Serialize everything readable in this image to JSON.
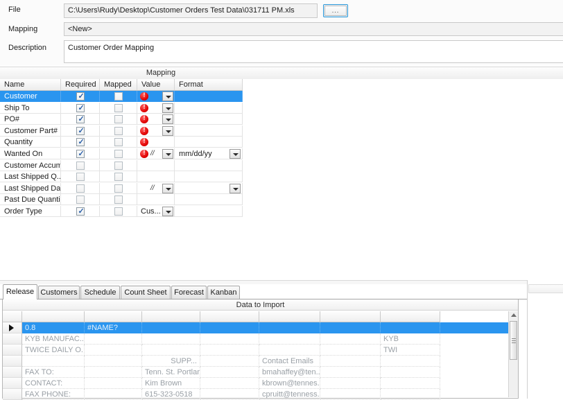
{
  "form": {
    "file_label": "File",
    "file_value": "C:\\Users\\Rudy\\Desktop\\Customer Orders Test Data\\031711 PM.xls",
    "browse_label": "...",
    "mapping_label": "Mapping",
    "mapping_value": "<New>",
    "description_label": "Description",
    "description_value": "Customer Order Mapping"
  },
  "mapping_band": {
    "title": "Mapping"
  },
  "grid": {
    "columns": [
      "Name",
      "Required",
      "Mapped",
      "Value",
      "Format"
    ],
    "rows": [
      {
        "name": "Customer",
        "required": true,
        "mapped": false,
        "error": true,
        "value_dropdown": true,
        "value_text": "",
        "slash": false,
        "format": "",
        "format_dropdown": false,
        "selected": true
      },
      {
        "name": "Ship To",
        "required": true,
        "mapped": false,
        "error": true,
        "value_dropdown": true,
        "value_text": "",
        "slash": false,
        "format": "",
        "format_dropdown": false,
        "selected": false
      },
      {
        "name": "PO#",
        "required": true,
        "mapped": false,
        "error": true,
        "value_dropdown": true,
        "value_text": "",
        "slash": false,
        "format": "",
        "format_dropdown": false,
        "selected": false
      },
      {
        "name": "Customer Part#",
        "required": true,
        "mapped": false,
        "error": true,
        "value_dropdown": true,
        "value_text": "",
        "slash": false,
        "format": "",
        "format_dropdown": false,
        "selected": false
      },
      {
        "name": "Quantity",
        "required": true,
        "mapped": false,
        "error": true,
        "value_dropdown": false,
        "value_text": "",
        "slash": false,
        "format": "",
        "format_dropdown": false,
        "selected": false
      },
      {
        "name": "Wanted On",
        "required": true,
        "mapped": false,
        "error": true,
        "value_dropdown": true,
        "value_text": "",
        "slash": true,
        "format": "mm/dd/yy",
        "format_dropdown": true,
        "selected": false
      },
      {
        "name": "Customer Accum",
        "required": false,
        "mapped": false,
        "error": false,
        "value_dropdown": false,
        "value_text": "",
        "slash": false,
        "format": "",
        "format_dropdown": false,
        "selected": false
      },
      {
        "name": "Last Shipped Q...",
        "required": false,
        "mapped": false,
        "error": false,
        "value_dropdown": false,
        "value_text": "",
        "slash": false,
        "format": "",
        "format_dropdown": false,
        "selected": false
      },
      {
        "name": "Last Shipped Da...",
        "required": false,
        "mapped": false,
        "error": false,
        "value_dropdown": true,
        "value_text": "",
        "slash": true,
        "format": "",
        "format_dropdown": true,
        "selected": false
      },
      {
        "name": "Past Due Quanti...",
        "required": false,
        "mapped": false,
        "error": false,
        "value_dropdown": false,
        "value_text": "",
        "slash": false,
        "format": "",
        "format_dropdown": false,
        "selected": false
      },
      {
        "name": "Order Type",
        "required": true,
        "mapped": false,
        "error": false,
        "value_dropdown": true,
        "value_text": "Cus...",
        "slash": false,
        "format": "",
        "format_dropdown": false,
        "selected": false
      }
    ]
  },
  "tabs": [
    {
      "label": "Release",
      "active": true
    },
    {
      "label": "Customers",
      "active": false
    },
    {
      "label": "Schedule",
      "active": false
    },
    {
      "label": "Count Sheet",
      "active": false
    },
    {
      "label": "Forecast",
      "active": false
    },
    {
      "label": "Kanban",
      "active": false
    }
  ],
  "data_grid": {
    "title": "Data to Import",
    "rows": [
      {
        "selected": true,
        "marker": true,
        "cells": [
          "0.8",
          "#NAME?",
          "",
          "",
          "",
          "",
          ""
        ]
      },
      {
        "selected": false,
        "marker": false,
        "cells": [
          "KYB MANUFAC...",
          "",
          "",
          "",
          "",
          "",
          "KYB"
        ]
      },
      {
        "selected": false,
        "marker": false,
        "cells": [
          "TWICE DAILY O...",
          "",
          "",
          "",
          "",
          "",
          "TWI"
        ]
      },
      {
        "selected": false,
        "marker": false,
        "cells": [
          "",
          "",
          "SUPP...",
          "",
          "Contact Emails",
          "",
          ""
        ]
      },
      {
        "selected": false,
        "marker": false,
        "cells": [
          "FAX TO:",
          "",
          "Tenn. St. Portlan...",
          "",
          "bmahaffey@ten...",
          "",
          ""
        ]
      },
      {
        "selected": false,
        "marker": false,
        "cells": [
          "CONTACT:",
          "",
          "Kim Brown",
          "",
          "kbrown@tennes...",
          "",
          ""
        ]
      },
      {
        "selected": false,
        "marker": false,
        "cells": [
          "FAX PHONE:",
          "",
          "615-323-0518",
          "",
          "cpruitt@tenness...",
          "",
          ""
        ]
      }
    ]
  },
  "colors": {
    "selection_blue": "#2a95ef",
    "error_red": "#e00000",
    "focus_blue": "#2e96d6"
  }
}
